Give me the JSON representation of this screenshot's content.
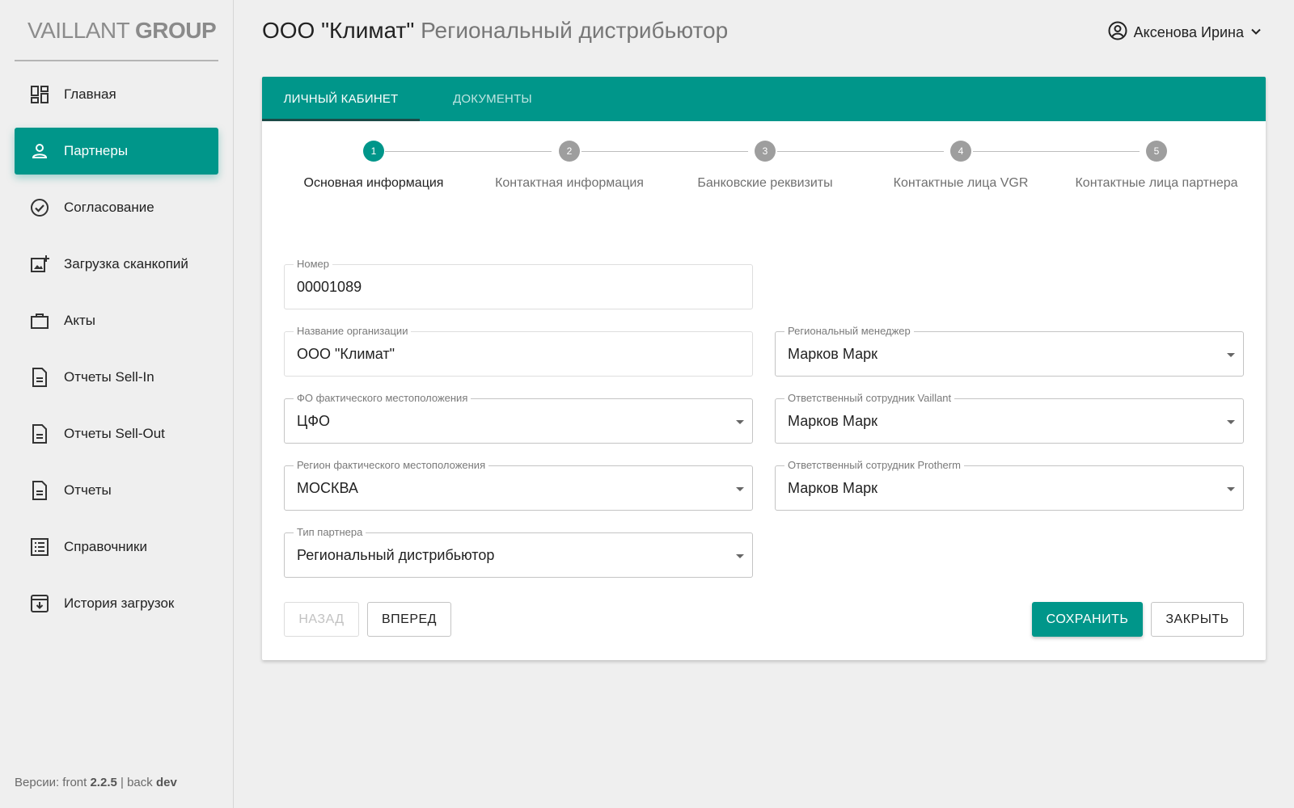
{
  "sidebar": {
    "logo": {
      "part1": "VAILLANT ",
      "part2": "GROUP"
    },
    "items": [
      {
        "label": "Главная",
        "icon": "dashboard-icon"
      },
      {
        "label": "Партнеры",
        "icon": "person-icon",
        "active": true
      },
      {
        "label": "Согласование",
        "icon": "check-circle-icon"
      },
      {
        "label": "Загрузка сканкопий",
        "icon": "add-photo-icon"
      },
      {
        "label": "Акты",
        "icon": "briefcase-icon"
      },
      {
        "label": "Отчеты Sell-In",
        "icon": "document-icon"
      },
      {
        "label": "Отчеты Sell-Out",
        "icon": "document-icon"
      },
      {
        "label": "Отчеты",
        "icon": "document-icon"
      },
      {
        "label": "Справочники",
        "icon": "list-icon"
      },
      {
        "label": "История загрузок",
        "icon": "archive-icon"
      }
    ],
    "version": {
      "prefix": "Версии: front ",
      "front": "2.2.5",
      "sep": " | back ",
      "back": "dev"
    }
  },
  "header": {
    "title_org": "ООО \"Климат\"",
    "title_type": " Региональный дистрибьютор",
    "user_name": "Аксенова Ирина"
  },
  "tabs": [
    {
      "label": "ЛИЧНЫЙ КАБИНЕТ",
      "active": true
    },
    {
      "label": "ДОКУМЕНТЫ"
    }
  ],
  "steps": [
    {
      "num": "1",
      "label": "Основная информация",
      "active": true
    },
    {
      "num": "2",
      "label": "Контактная информация"
    },
    {
      "num": "3",
      "label": "Банковские реквизиты"
    },
    {
      "num": "4",
      "label": "Контактные лица VGR"
    },
    {
      "num": "5",
      "label": "Контактные лица партнера"
    }
  ],
  "form": {
    "number": {
      "label": "Номер",
      "value": "00001089"
    },
    "org_name": {
      "label": "Название организации",
      "value": "ООО \"Климат\""
    },
    "fo": {
      "label": "ФО фактического местоположения",
      "value": "ЦФО"
    },
    "region": {
      "label": "Регион фактического местоположения",
      "value": "МОСКВА"
    },
    "partner_type": {
      "label": "Тип партнера",
      "value": "Региональный дистрибьютор"
    },
    "regional_manager": {
      "label": "Региональный менеджер",
      "value": "Марков Марк"
    },
    "vaillant_employee": {
      "label": "Ответственный сотрудник Vaillant",
      "value": "Марков Марк"
    },
    "protherm_employee": {
      "label": "Ответственный сотрудник Protherm",
      "value": "Марков Марк"
    }
  },
  "buttons": {
    "back": "НАЗАД",
    "next": "ВПЕРЕД",
    "save": "СОХРАНИТЬ",
    "close": "ЗАКРЫТЬ"
  },
  "colors": {
    "accent": "#00968a",
    "tab_indicator": "#1b4a47",
    "step_inactive": "#9e9e9e"
  }
}
